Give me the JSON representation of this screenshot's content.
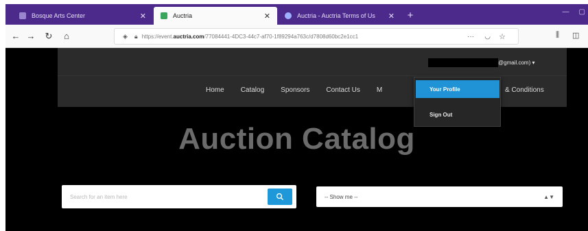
{
  "browser": {
    "tabs": [
      {
        "label": "Bosque Arts Center",
        "active": false
      },
      {
        "label": "Auctria",
        "active": true
      },
      {
        "label": "Auctria - Auctria Terms of Us",
        "active": false
      }
    ],
    "new_tab": "+",
    "url_prefix": "https://event.",
    "url_domain": "auctria.com",
    "url_rest": "/77084441-4DC3-44c7-af70-1f89294a763c/d7808d60bc2e1cc1"
  },
  "site": {
    "account_suffix": "@gmail.com) ▾",
    "menu": [
      "Home",
      "Catalog",
      "Sponsors",
      "Contact Us"
    ],
    "menu_partial": "M",
    "menu_tail": "& Conditions",
    "dropdown": {
      "profile": "Your Profile",
      "signout": "Sign Out"
    },
    "title": "Auction Catalog",
    "search_placeholder": "Search for an item here",
    "filter_value": "-- Show me --"
  },
  "colors": {
    "tabbar": "#4b2a8c",
    "header": "#2b2b2b",
    "accent": "#1e98d8",
    "title": "#6b6b6b"
  }
}
